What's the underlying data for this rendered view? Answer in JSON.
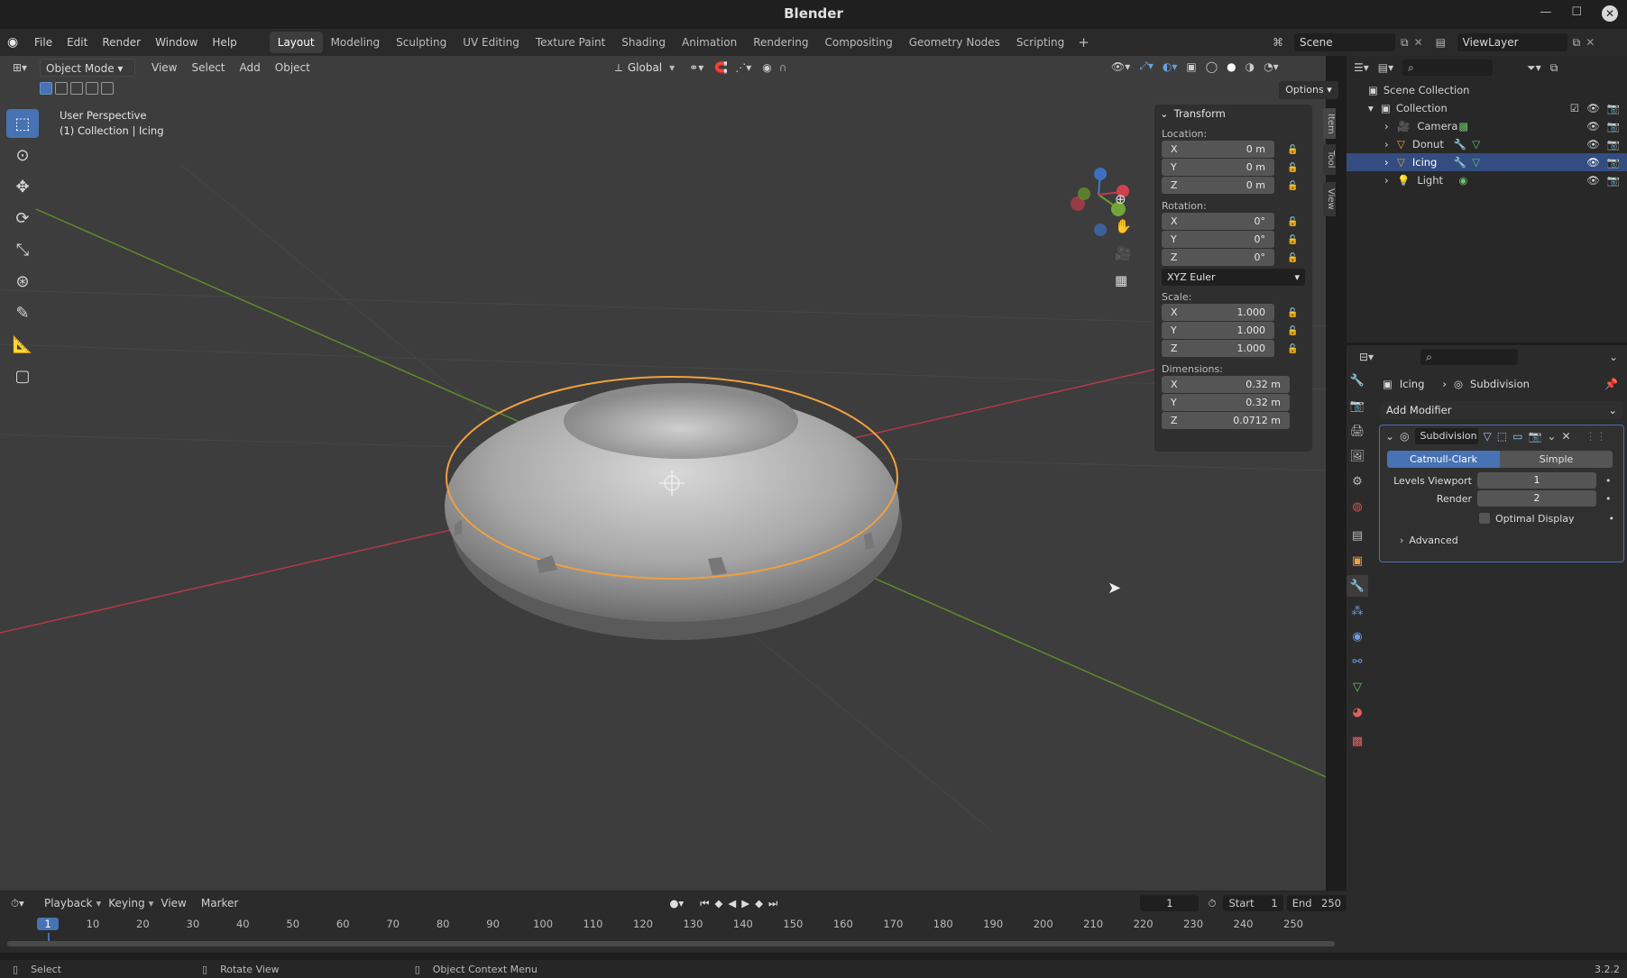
{
  "window": {
    "title": "Blender",
    "version": "3.2.2"
  },
  "menu": [
    "File",
    "Edit",
    "Render",
    "Window",
    "Help"
  ],
  "workspaces": [
    "Layout",
    "Modeling",
    "Sculpting",
    "UV Editing",
    "Texture Paint",
    "Shading",
    "Animation",
    "Rendering",
    "Compositing",
    "Geometry Nodes",
    "Scripting"
  ],
  "active_workspace": "Layout",
  "scene": {
    "name": "Scene",
    "view_layer": "ViewLayer"
  },
  "viewport_header": {
    "mode": "Object Mode",
    "menus": [
      "View",
      "Select",
      "Add",
      "Object"
    ],
    "orientation": "Global",
    "options": "Options"
  },
  "viewport": {
    "perspective": "User Perspective",
    "context": "(1) Collection | Icing"
  },
  "transform": {
    "title": "Transform",
    "location_label": "Location:",
    "location": [
      [
        "X",
        "0 m"
      ],
      [
        "Y",
        "0 m"
      ],
      [
        "Z",
        "0 m"
      ]
    ],
    "rotation_label": "Rotation:",
    "rotation": [
      [
        "X",
        "0°"
      ],
      [
        "Y",
        "0°"
      ],
      [
        "Z",
        "0°"
      ]
    ],
    "rotation_mode": "XYZ Euler",
    "scale_label": "Scale:",
    "scale": [
      [
        "X",
        "1.000"
      ],
      [
        "Y",
        "1.000"
      ],
      [
        "Z",
        "1.000"
      ]
    ],
    "dimensions_label": "Dimensions:",
    "dimensions": [
      [
        "X",
        "0.32 m"
      ],
      [
        "Y",
        "0.32 m"
      ],
      [
        "Z",
        "0.0712 m"
      ]
    ]
  },
  "side_tabs": [
    "Item",
    "Tool",
    "View"
  ],
  "outliner": {
    "root": "Scene Collection",
    "collection": "Collection",
    "items": [
      "Camera",
      "Donut",
      "Icing",
      "Light"
    ],
    "selected": "Icing"
  },
  "properties": {
    "breadcrumb_object": "Icing",
    "breadcrumb_modifier": "Subdivision",
    "add_modifier": "Add Modifier",
    "modifier_name": "Subdivision",
    "method_a": "Catmull-Clark",
    "method_b": "Simple",
    "levels_viewport_label": "Levels Viewport",
    "levels_viewport": "1",
    "render_label": "Render",
    "render": "2",
    "optimal_display": "Optimal Display",
    "advanced": "Advanced"
  },
  "timeline": {
    "menus": [
      "Playback",
      "Keying",
      "View",
      "Marker"
    ],
    "current_frame": "1",
    "start_label": "Start",
    "start": "1",
    "end_label": "End",
    "end": "250",
    "ticks": [
      "1",
      "10",
      "20",
      "30",
      "40",
      "50",
      "60",
      "70",
      "80",
      "90",
      "100",
      "110",
      "120",
      "130",
      "140",
      "150",
      "160",
      "170",
      "180",
      "190",
      "200",
      "210",
      "220",
      "230",
      "240",
      "250"
    ]
  },
  "statusbar": {
    "select": "Select",
    "rotate": "Rotate View",
    "context_menu": "Object Context Menu"
  },
  "colors": {
    "accent": "#4772b3",
    "selection_outline": "#f0a040",
    "axis_x": "#c03a4a",
    "axis_y": "#6a9a2a"
  }
}
